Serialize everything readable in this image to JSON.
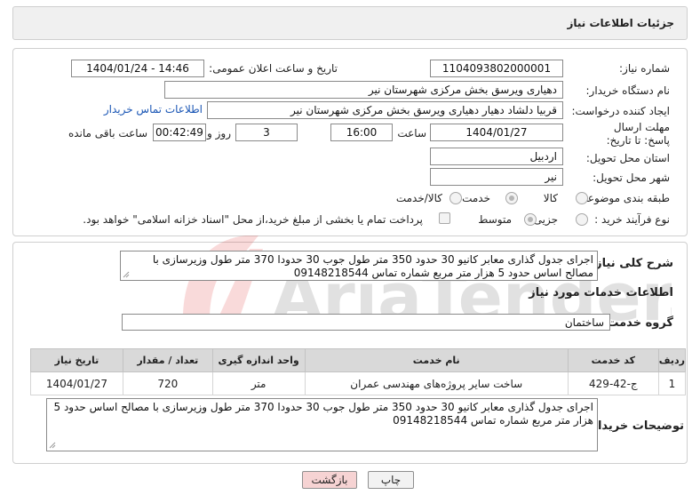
{
  "header": {
    "title": "جزئیات اطلاعات نیاز"
  },
  "form": {
    "need_number_label": "شماره نیاز:",
    "need_number": "1104093802000001",
    "announce_datetime_label": "تاریخ و ساعت اعلان عمومی:",
    "announce_datetime": "1404/01/24 - 14:46",
    "buyer_org_label": "نام دستگاه خریدار:",
    "buyer_org": "دهیاری ویرسق بخش مرکزی شهرستان نیر",
    "requester_label": "ایجاد کننده درخواست:",
    "requester": "قربیا دلشاد دهیار دهیاری ویرسق بخش مرکزی شهرستان نیر",
    "buyer_contact_link": "اطلاعات تماس خریدار",
    "deadline_label": "مهلت ارسال پاسخ: تا تاریخ:",
    "deadline_date": "1404/01/27",
    "time_label": "ساعت",
    "deadline_time": "16:00",
    "days_value": "3",
    "days_label": "روز و",
    "remaining_time": "00:42:49",
    "remaining_label": "ساعت باقی مانده",
    "province_label": "استان محل تحویل:",
    "province": "اردبیل",
    "city_label": "شهر محل تحویل:",
    "city": "نیر",
    "category_label": "طبقه بندی موضوعی:",
    "category_options": [
      "کالا",
      "خدمت",
      "کالا/خدمت"
    ],
    "category_selected": "خدمت",
    "process_label": "نوع فرآیند خرید :",
    "process_options": [
      "جزیی",
      "متوسط"
    ],
    "process_selected": "متوسط",
    "payment_note": "پرداخت تمام یا بخشی از مبلغ خرید،از محل \"اسناد خزانه اسلامی\" خواهد بود."
  },
  "summary": {
    "label": "شرح کلی نیاز:",
    "text": "اجرای جدول گذاری معابر کانیو 30 حدود 350 متر طول جوب 30 حدودا 370 متر طول وزیرسازی با مصالح اساس حدود 5 هزار متر مربع شماره تماس 09148218544"
  },
  "services": {
    "section_title": "اطلاعات خدمات مورد نیاز",
    "group_label": "گروه خدمت:",
    "group_value": "ساختمان",
    "columns": [
      "ردیف",
      "کد خدمت",
      "نام خدمت",
      "واحد اندازه گیری",
      "تعداد / مقدار",
      "تاریخ نیاز"
    ],
    "rows": [
      {
        "row": "1",
        "code": "ج-42-429",
        "name": "ساخت سایر پروژه‌های مهندسی عمران",
        "unit": "متر",
        "qty": "720",
        "date": "1404/01/27"
      }
    ]
  },
  "buyer_notes": {
    "label": "توضیحات خریدار:",
    "text": "اجرای جدول گذاری معابر کانیو 30 حدود 350 متر طول جوب 30 حدودا 370 متر طول وزیرسازی با مصالح اساس حدود 5 هزار متر مربع شماره تماس 09148218544"
  },
  "buttons": {
    "print": "چاپ",
    "back": "بازگشت"
  },
  "watermark": {
    "text": "AriaTender.neT"
  },
  "colors": {
    "link": "#1a56b5",
    "back_button": "#f6d3d3",
    "header_bg": "#f0f0f0",
    "table_header": "#d9d9d9"
  }
}
